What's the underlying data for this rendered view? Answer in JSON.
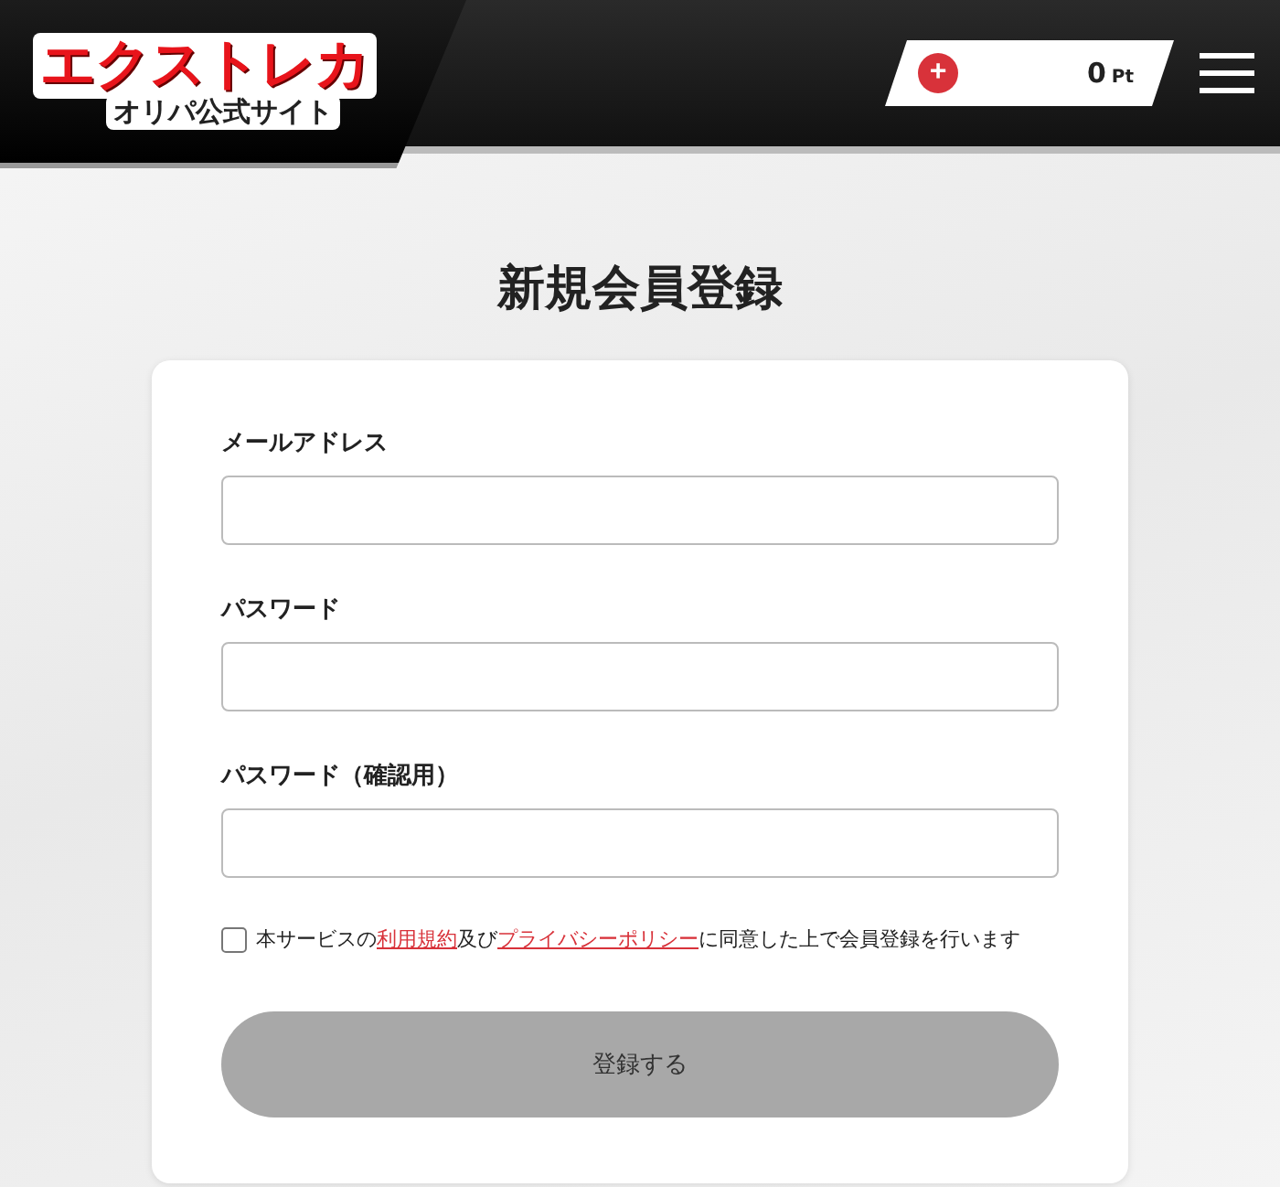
{
  "header": {
    "logo": {
      "title": "エクストレカ",
      "subtitle": "オリパ公式サイト"
    },
    "points": {
      "add_symbol": "+",
      "value": "0",
      "unit": "Pt"
    }
  },
  "page_title": "新規会員登録",
  "form": {
    "fields": [
      {
        "label": "メールアドレス"
      },
      {
        "label": "パスワード"
      },
      {
        "label": "パスワード（確認用）"
      }
    ],
    "agreement": {
      "checked": false,
      "parts": [
        {
          "kind": "text",
          "text": "本サービスの"
        },
        {
          "kind": "link",
          "text": "利用規約"
        },
        {
          "kind": "text",
          "text": "及び"
        },
        {
          "kind": "link",
          "text": "プライバシーポリシー"
        },
        {
          "kind": "text",
          "text": "に同意した上で会員登録を行います"
        }
      ]
    },
    "submit": {
      "label": "登録する",
      "disabled": true
    }
  }
}
